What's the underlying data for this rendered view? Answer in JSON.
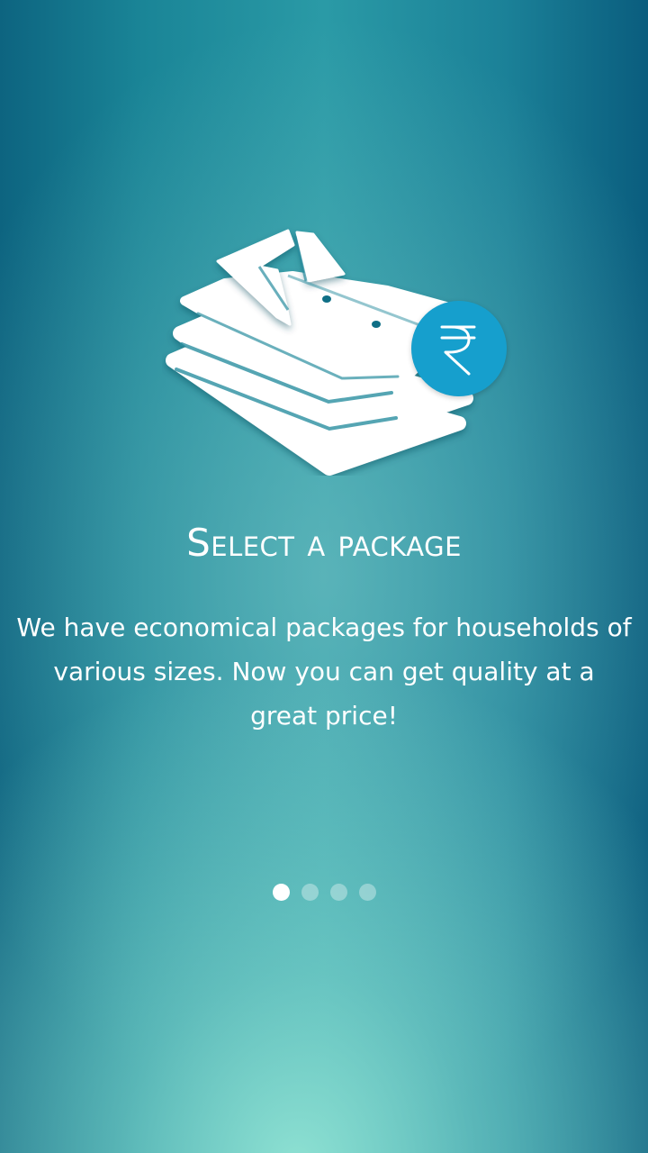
{
  "onboarding": {
    "illustration_icon": "folded-shirts-icon",
    "badge_icon": "rupee-icon",
    "badge_symbol": "₹",
    "badge_color": "#169fcd",
    "title": "Select a package",
    "description": "We have economical packages for households of various sizes. Now you can get quality at a great price!"
  },
  "pager": {
    "total_pages": 4,
    "current_page": 1
  },
  "colors": {
    "background_edge": "#0a5d7e",
    "background_center": "#2a9aa6",
    "background_glow": "#8de0d2",
    "text": "#ffffff"
  }
}
